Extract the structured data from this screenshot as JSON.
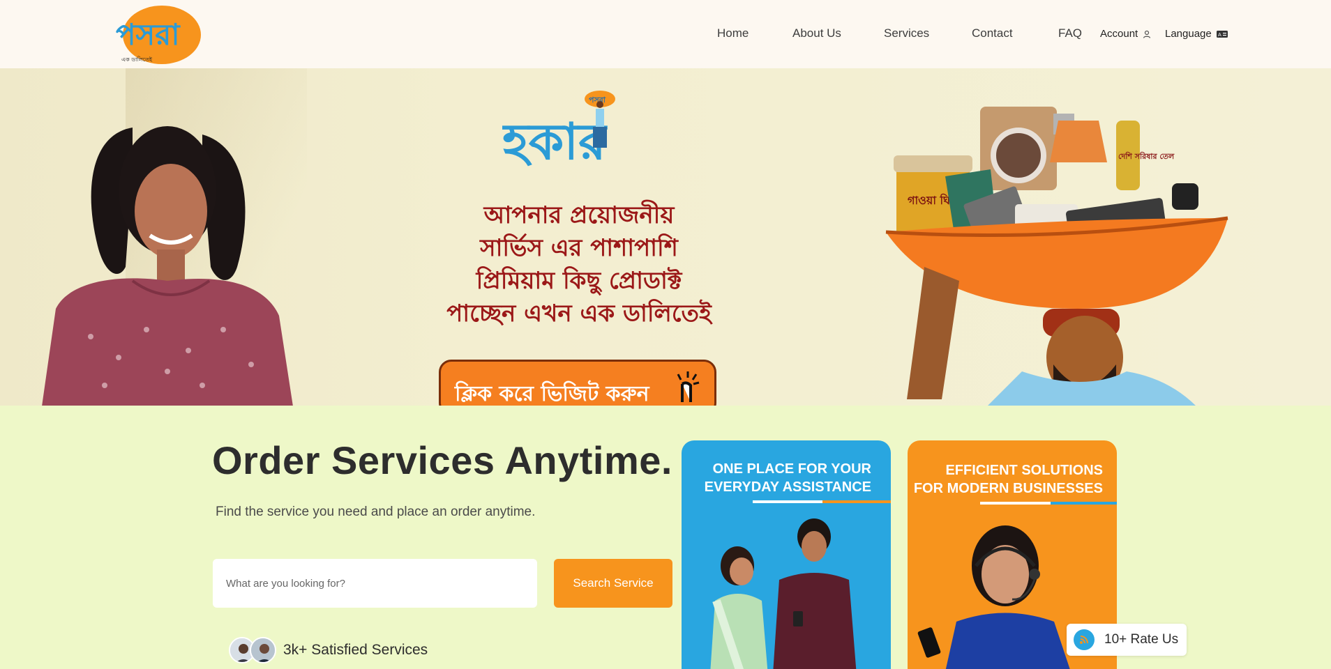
{
  "brand": {
    "logo_text": "পসরা",
    "logo_tagline": "এক ডালিতেই"
  },
  "nav": {
    "items": [
      "Home",
      "About Us",
      "Services",
      "Contact",
      "FAQ"
    ],
    "account_label": "Account",
    "language_label": "Language"
  },
  "hero": {
    "logo_text": "হকার",
    "logo_badge": "পসরা",
    "lines": [
      "আপনার প্রয়োজনীয়",
      "সার্ভিস এর পাশাপাশি",
      "প্রিমিয়াম কিছু প্রোডাক্ট",
      "পাচ্ছেন এখন এক ডালিতেই"
    ],
    "cta_label": "ক্লিক করে ভিজিট করুন",
    "jar_label": "গাওয়া ঘি",
    "bottle_label": "দেশি সরিষার তেল"
  },
  "main": {
    "headline": "Order Services Anytime.",
    "subline": "Find the service you need and place an order anytime.",
    "search_placeholder": "What are you looking for?",
    "search_button": "Search Service",
    "satisfied_text": "3k+ Satisfied Services"
  },
  "cards": [
    {
      "title_line1": "ONE PLACE FOR YOUR",
      "title_line2": "EVERYDAY ASSISTANCE"
    },
    {
      "title_line1": "EFFICIENT SOLUTIONS",
      "title_line2": "FOR MODERN BUSINESSES"
    }
  ],
  "rate": {
    "label": "10+ Rate Us"
  },
  "colors": {
    "accent_orange": "#f7941d",
    "accent_blue": "#29a6e0",
    "hero_red": "#9b1818",
    "page_bg": "#eef8c8",
    "header_bg": "#fdf8f1"
  }
}
